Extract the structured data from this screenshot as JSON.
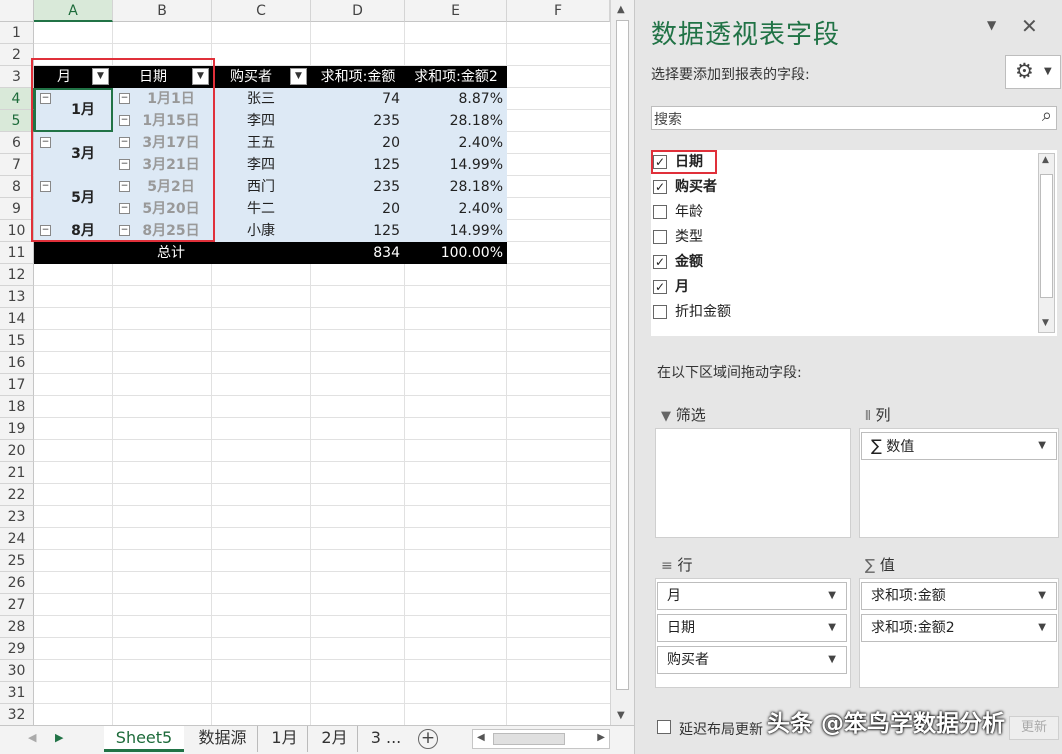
{
  "columns": [
    "A",
    "B",
    "C",
    "D",
    "E",
    "F"
  ],
  "rows": [
    "1",
    "2",
    "3",
    "4",
    "5",
    "6",
    "7",
    "8",
    "9",
    "10",
    "11",
    "12",
    "13",
    "14",
    "15",
    "16",
    "17",
    "18",
    "19",
    "20",
    "21",
    "22",
    "23",
    "24",
    "25",
    "26",
    "27",
    "28",
    "29",
    "30",
    "31",
    "32"
  ],
  "pivot": {
    "headers": [
      "月",
      "日期",
      "购买者",
      "求和项:金额",
      "求和项:金额2"
    ],
    "months": [
      "1月",
      "3月",
      "5月",
      "8月"
    ],
    "rows": [
      {
        "date": "1月1日",
        "buyer": "张三",
        "amount": "74",
        "pct": "8.87%"
      },
      {
        "date": "1月15日",
        "buyer": "李四",
        "amount": "235",
        "pct": "28.18%"
      },
      {
        "date": "3月17日",
        "buyer": "王五",
        "amount": "20",
        "pct": "2.40%"
      },
      {
        "date": "3月21日",
        "buyer": "李四",
        "amount": "125",
        "pct": "14.99%"
      },
      {
        "date": "5月2日",
        "buyer": "西门",
        "amount": "235",
        "pct": "28.18%"
      },
      {
        "date": "5月20日",
        "buyer": "牛二",
        "amount": "20",
        "pct": "2.40%"
      },
      {
        "date": "8月25日",
        "buyer": "小康",
        "amount": "125",
        "pct": "14.99%"
      }
    ],
    "total": {
      "label": "总计",
      "amount": "834",
      "pct": "100.00%"
    }
  },
  "tabs": [
    "Sheet5",
    "数据源",
    "1月",
    "2月",
    "3 ..."
  ],
  "panel": {
    "title": "数据透视表字段",
    "choose_label": "选择要添加到报表的字段:",
    "search_placeholder": "搜索",
    "fields": [
      {
        "name": "日期",
        "checked": true
      },
      {
        "name": "购买者",
        "checked": true
      },
      {
        "name": "年龄",
        "checked": false
      },
      {
        "name": "类型",
        "checked": false
      },
      {
        "name": "金额",
        "checked": true
      },
      {
        "name": "月",
        "checked": true
      },
      {
        "name": "折扣金额",
        "checked": false
      }
    ],
    "drag_label": "在以下区域间拖动字段:",
    "filter_label": "筛选",
    "columns_label": "列",
    "rows_label": "行",
    "values_label": "值",
    "column_items": [
      "数值"
    ],
    "row_items": [
      "月",
      "日期",
      "购买者"
    ],
    "value_items": [
      "求和项:金额",
      "求和项:金额2"
    ],
    "defer_label": "延迟布局更新",
    "update_label": "更新"
  },
  "watermark": "头条 @笨鸟学数据分析",
  "colors": {
    "accent": "#217346",
    "highlight": "#e0303a",
    "band": "#dde9f5"
  }
}
